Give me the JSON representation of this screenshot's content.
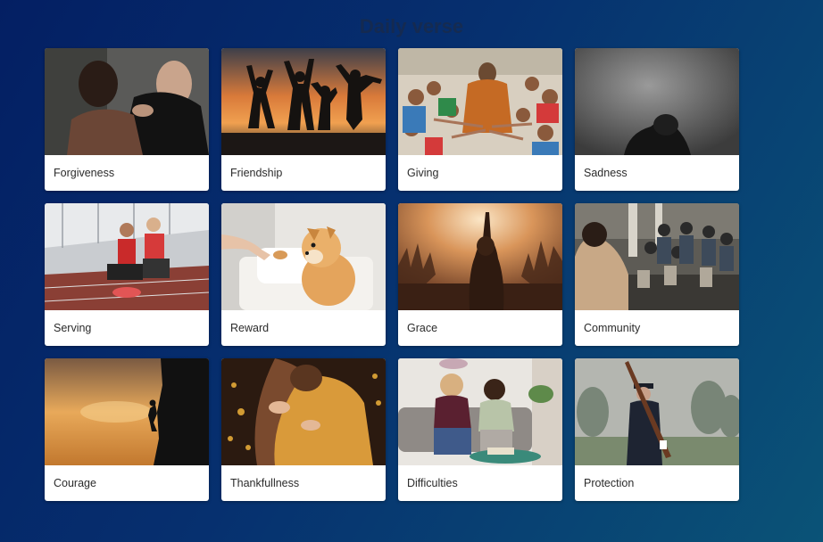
{
  "page": {
    "title": "Daily verse"
  },
  "cards": [
    {
      "label": "Forgiveness",
      "image": "two-people-embracing"
    },
    {
      "label": "Friendship",
      "image": "silhouettes-jumping-at-sunset"
    },
    {
      "label": "Giving",
      "image": "monk-with-children-reaching-hands"
    },
    {
      "label": "Sadness",
      "image": "person-head-down-in-gray-room"
    },
    {
      "label": "Serving",
      "image": "athlete-helping-runner-on-track"
    },
    {
      "label": "Reward",
      "image": "hand-and-pomeranian-dog"
    },
    {
      "label": "Grace",
      "image": "woman-in-sunset-field"
    },
    {
      "label": "Community",
      "image": "group-sitting-in-circle"
    },
    {
      "label": "Courage",
      "image": "climber-on-cliff-at-sunset"
    },
    {
      "label": "Thankfullness",
      "image": "hug-with-bokeh-lights"
    },
    {
      "label": "Difficulties",
      "image": "two-people-on-couch-consoling"
    },
    {
      "label": "Protection",
      "image": "soldier-with-rifle"
    }
  ]
}
